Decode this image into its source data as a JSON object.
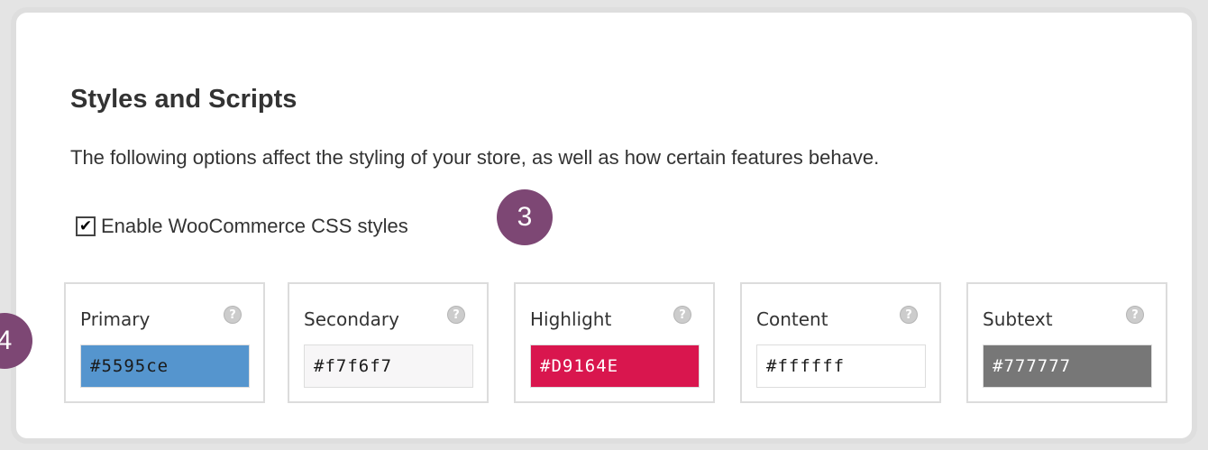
{
  "section": {
    "title": "Styles and Scripts",
    "description": "The following options affect the styling of your store, as well as how certain features behave."
  },
  "css_option": {
    "checked": true,
    "label": "Enable WooCommerce CSS styles"
  },
  "step_badges": [
    "3",
    "4"
  ],
  "colors": [
    {
      "label": "Primary",
      "value": "#5595ce",
      "bg": "#5595ce",
      "text_color": "#1a1a1a"
    },
    {
      "label": "Secondary",
      "value": "#f7f6f7",
      "bg": "#f7f6f7",
      "text_color": "#1a1a1a"
    },
    {
      "label": "Highlight",
      "value": "#D9164E",
      "bg": "#d9164e",
      "text_color": "#ffffff"
    },
    {
      "label": "Content",
      "value": "#ffffff",
      "bg": "#ffffff",
      "text_color": "#1a1a1a"
    },
    {
      "label": "Subtext",
      "value": "#777777",
      "bg": "#777777",
      "text_color": "#ffffff"
    }
  ],
  "help_icon": "question-mark-icon",
  "accent_color": "#7d4774"
}
